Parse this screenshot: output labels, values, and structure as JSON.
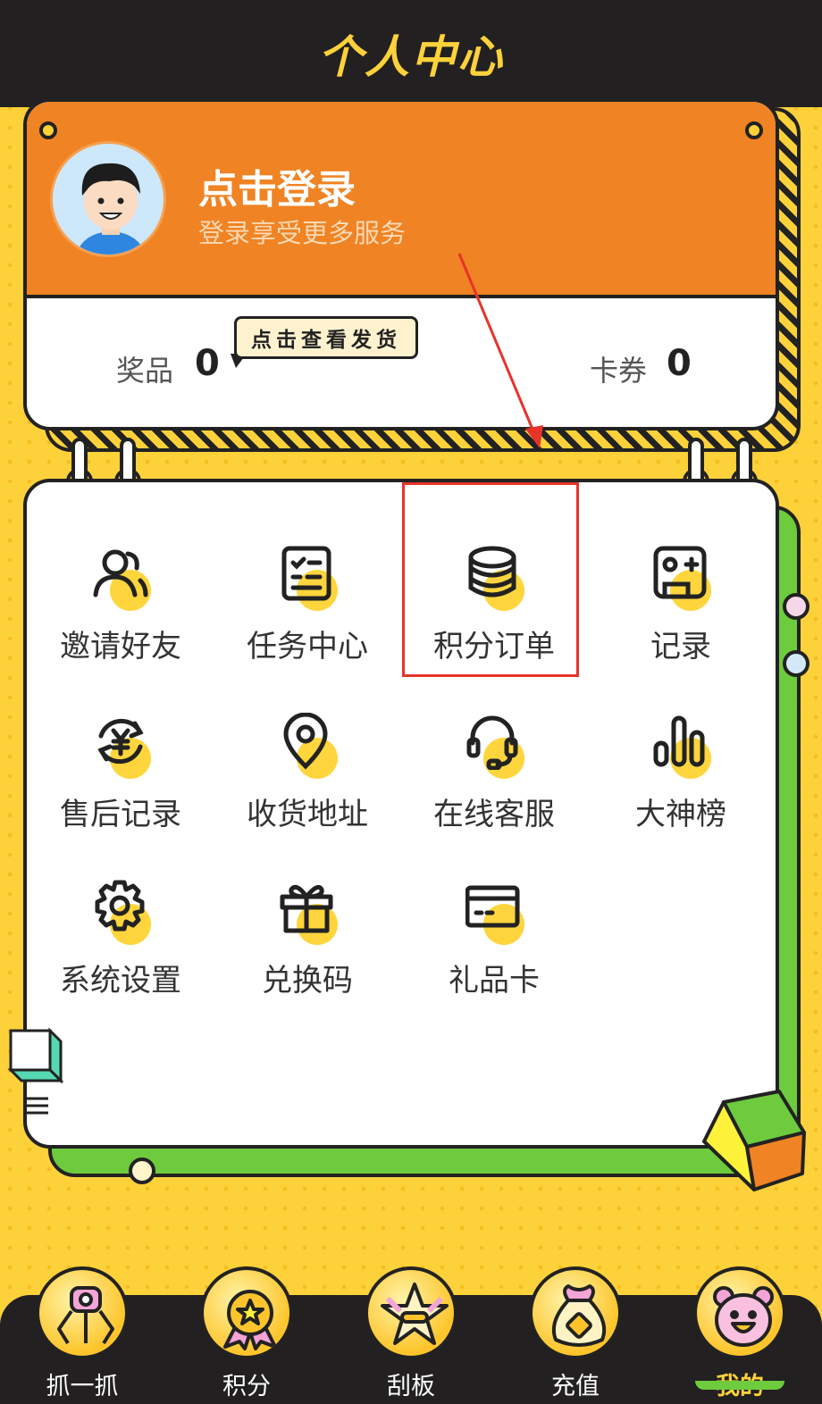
{
  "header": {
    "title": "个人中心"
  },
  "profile": {
    "login_title": "点击登录",
    "login_subtitle": "登录享受更多服务",
    "prizes_label": "奖品",
    "prizes_count": "0",
    "coupons_label": "卡券",
    "coupons_count": "0",
    "bubble_text": "点击查看发货"
  },
  "menu": {
    "items": [
      {
        "label": "邀请好友",
        "icon": "invite-friends-icon"
      },
      {
        "label": "任务中心",
        "icon": "task-list-icon"
      },
      {
        "label": "积分订单",
        "icon": "coins-stack-icon"
      },
      {
        "label": "记录",
        "icon": "game-record-icon"
      },
      {
        "label": "售后记录",
        "icon": "yen-refresh-icon"
      },
      {
        "label": "收货地址",
        "icon": "location-pin-icon"
      },
      {
        "label": "在线客服",
        "icon": "headset-icon"
      },
      {
        "label": "大神榜",
        "icon": "bar-chart-icon"
      },
      {
        "label": "系统设置",
        "icon": "gear-icon"
      },
      {
        "label": "兑换码",
        "icon": "gift-icon"
      },
      {
        "label": "礼品卡",
        "icon": "card-icon"
      }
    ],
    "highlighted_item": "积分订单"
  },
  "bottom_nav": {
    "items": [
      {
        "label": "抓一抓",
        "icon": "claw-machine-icon",
        "active": false
      },
      {
        "label": "积分",
        "icon": "medal-star-icon",
        "active": false
      },
      {
        "label": "刮板",
        "icon": "star-scratch-icon",
        "active": false
      },
      {
        "label": "充值",
        "icon": "money-bag-icon",
        "active": false
      },
      {
        "label": "我的",
        "icon": "bear-face-icon",
        "active": true
      }
    ]
  },
  "colors": {
    "background": "#fdd13a",
    "header_bg": "#222021",
    "profile_orange": "#f08323",
    "accent_green": "#6dcb3d",
    "highlight_red": "#e8332a"
  }
}
